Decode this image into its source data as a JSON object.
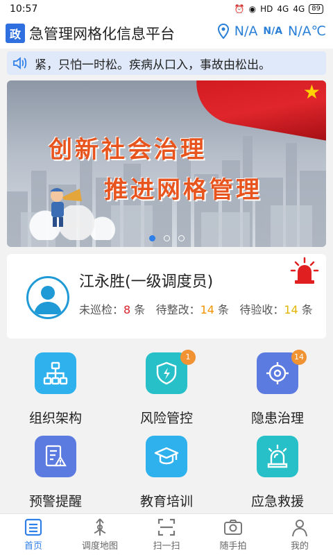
{
  "status_bar": {
    "time": "10:57",
    "network": "HD",
    "signal1": "4G",
    "signal2": "4G",
    "battery": "89"
  },
  "header": {
    "badge": "政",
    "title": "急管理网格化信息平台",
    "location": "N/A",
    "weather": "N/A",
    "temperature": "N/A℃"
  },
  "notice": {
    "text": "紧，只怕一时松。疾病从口入，事故由松出。"
  },
  "banner": {
    "line1": "创新社会治理",
    "line2": "推进网格管理",
    "slide_count": 3,
    "active_slide": 1
  },
  "user": {
    "name": "江永胜(一级调度员)",
    "stat1_label": "未巡检：",
    "stat1_value": "8",
    "stat1_unit": "条",
    "stat2_label": "待整改：",
    "stat2_value": "14",
    "stat2_unit": "条",
    "stat3_label": "待验收：",
    "stat3_value": "14",
    "stat3_unit": "条"
  },
  "grid": [
    {
      "label": "组织架构",
      "icon": "org-chart-icon",
      "badge": ""
    },
    {
      "label": "风险管控",
      "icon": "shield-bolt-icon",
      "badge": "1"
    },
    {
      "label": "隐患治理",
      "icon": "target-icon",
      "badge": "14"
    },
    {
      "label": "预警提醒",
      "icon": "warning-doc-icon",
      "badge": ""
    },
    {
      "label": "教育培训",
      "icon": "graduation-cap-icon",
      "badge": ""
    },
    {
      "label": "应急救援",
      "icon": "siren-icon",
      "badge": ""
    }
  ],
  "bottom_nav": [
    {
      "label": "首页",
      "icon": "home-list-icon",
      "active": true
    },
    {
      "label": "调度地图",
      "icon": "map-pin-icon",
      "active": false
    },
    {
      "label": "扫一扫",
      "icon": "scan-icon",
      "active": false
    },
    {
      "label": "随手拍",
      "icon": "camera-icon",
      "active": false
    },
    {
      "label": "我的",
      "icon": "user-icon",
      "active": false
    }
  ],
  "colors": {
    "primary": "#2f7fe8",
    "tile_blue": "#2fb1ee",
    "tile_teal": "#27c0c9",
    "tile_indigo": "#5b7be0",
    "badge": "#f19233"
  }
}
